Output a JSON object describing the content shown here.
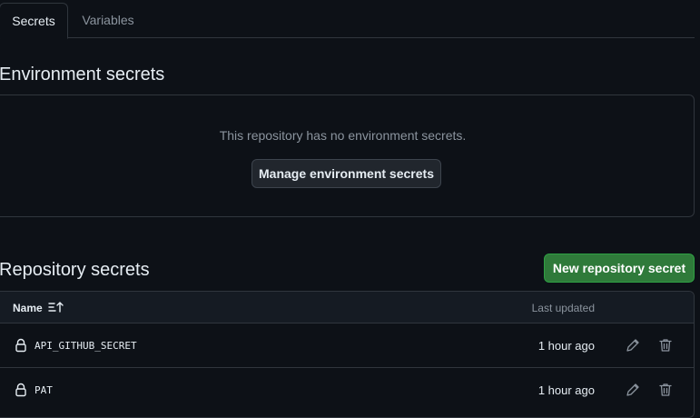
{
  "tabs": [
    {
      "label": "Secrets",
      "active": true
    },
    {
      "label": "Variables",
      "active": false
    }
  ],
  "environment": {
    "heading": "Environment secrets",
    "empty_text": "This repository has no environment secrets.",
    "manage_button": "Manage environment secrets"
  },
  "repository": {
    "heading": "Repository secrets",
    "new_button": "New repository secret",
    "columns": {
      "name": "Name",
      "updated": "Last updated"
    },
    "rows": [
      {
        "name": "API_GITHUB_SECRET",
        "updated": "1 hour ago"
      },
      {
        "name": "PAT",
        "updated": "1 hour ago"
      }
    ]
  },
  "icons": {
    "sort": "sort-ascending-icon",
    "lock": "lock-icon",
    "edit": "pencil-icon",
    "delete": "trash-icon"
  },
  "colors": {
    "background": "#0d1117",
    "border": "#30363d",
    "primary_button": "#2f7a3a",
    "muted_text": "#8b949e"
  }
}
